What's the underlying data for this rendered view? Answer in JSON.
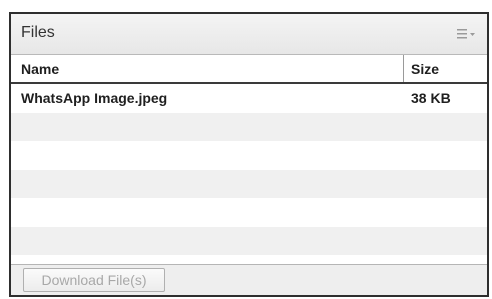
{
  "pod": {
    "title": "Files",
    "menu_icon": "list-menu-icon"
  },
  "table": {
    "columns": [
      "Name",
      "Size"
    ],
    "rows": [
      {
        "name": "WhatsApp Image.jpeg",
        "size": "38 KB"
      }
    ]
  },
  "footer": {
    "download_label": "Download File(s)",
    "download_enabled": false
  },
  "colors": {
    "border": "#2e2e2e",
    "stripe": "#f0f0f0",
    "disabled_text": "#a8a8a8"
  }
}
